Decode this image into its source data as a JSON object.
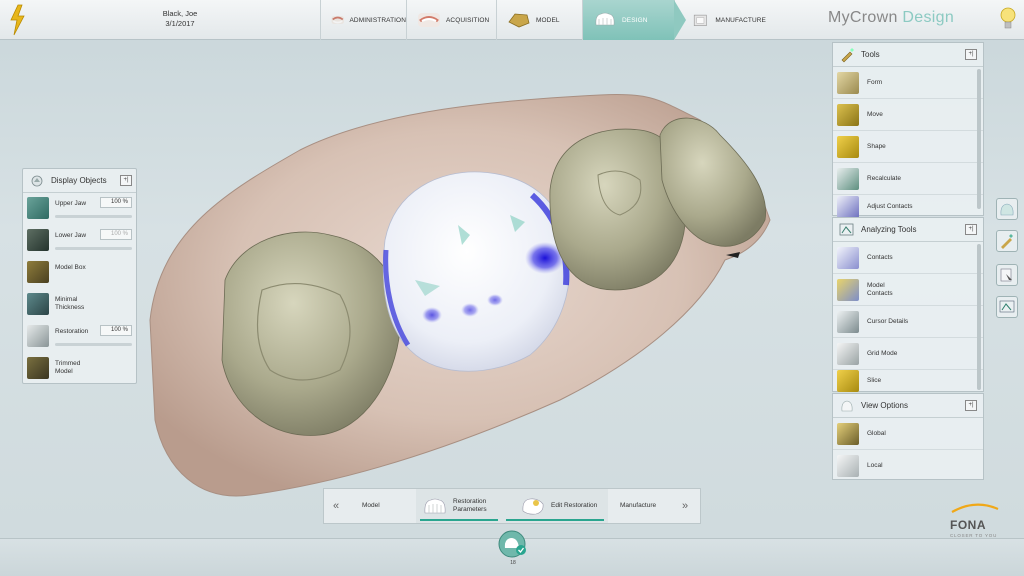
{
  "header": {
    "patient_name": "Black, Joe",
    "patient_date": "3/1/2017",
    "workflow": [
      {
        "label": "ADMINISTRATION",
        "active": false
      },
      {
        "label": "ACQUISITION",
        "active": false
      },
      {
        "label": "MODEL",
        "active": false
      },
      {
        "label": "DESIGN",
        "active": true
      },
      {
        "label": "MANUFACTURE",
        "active": false
      }
    ],
    "brand_main": "MyCrown",
    "brand_accent": "Design"
  },
  "display_objects": {
    "title": "Display Objects",
    "pin": "+|",
    "items": [
      {
        "label": "Upper Jaw",
        "value": "100 %",
        "dim": false
      },
      {
        "label": "Lower Jaw",
        "value": "100 %",
        "dim": true
      },
      {
        "label": "Model Box"
      },
      {
        "label": "Minimal Thickness"
      },
      {
        "label": "Restoration",
        "value": "100 %",
        "dim": false
      },
      {
        "label": "Trimmed Model"
      }
    ]
  },
  "tools": {
    "title": "Tools",
    "pin": "+|",
    "items": [
      "Form",
      "Move",
      "Shape",
      "Recalculate",
      "Adjust Contacts"
    ]
  },
  "analyzing_tools": {
    "title": "Analyzing Tools",
    "pin": "+|",
    "items": [
      "Contacts",
      "Model Contacts",
      "Cursor Details",
      "Grid Mode",
      "Slice"
    ]
  },
  "view_options": {
    "title": "View Options",
    "pin": "+|",
    "items": [
      "Global",
      "Local"
    ]
  },
  "steps": {
    "prev_chevron": "«",
    "next_chevron": "»",
    "items": [
      "Model",
      "Restoration Parameters",
      "Edit Restoration",
      "Manufacture"
    ]
  },
  "logo": {
    "name": "FONA",
    "tagline": "CLOSER TO YOU"
  },
  "status_label": "18",
  "colors": {
    "accent": "#8ccac2",
    "active_underline": "#2aa58f"
  }
}
